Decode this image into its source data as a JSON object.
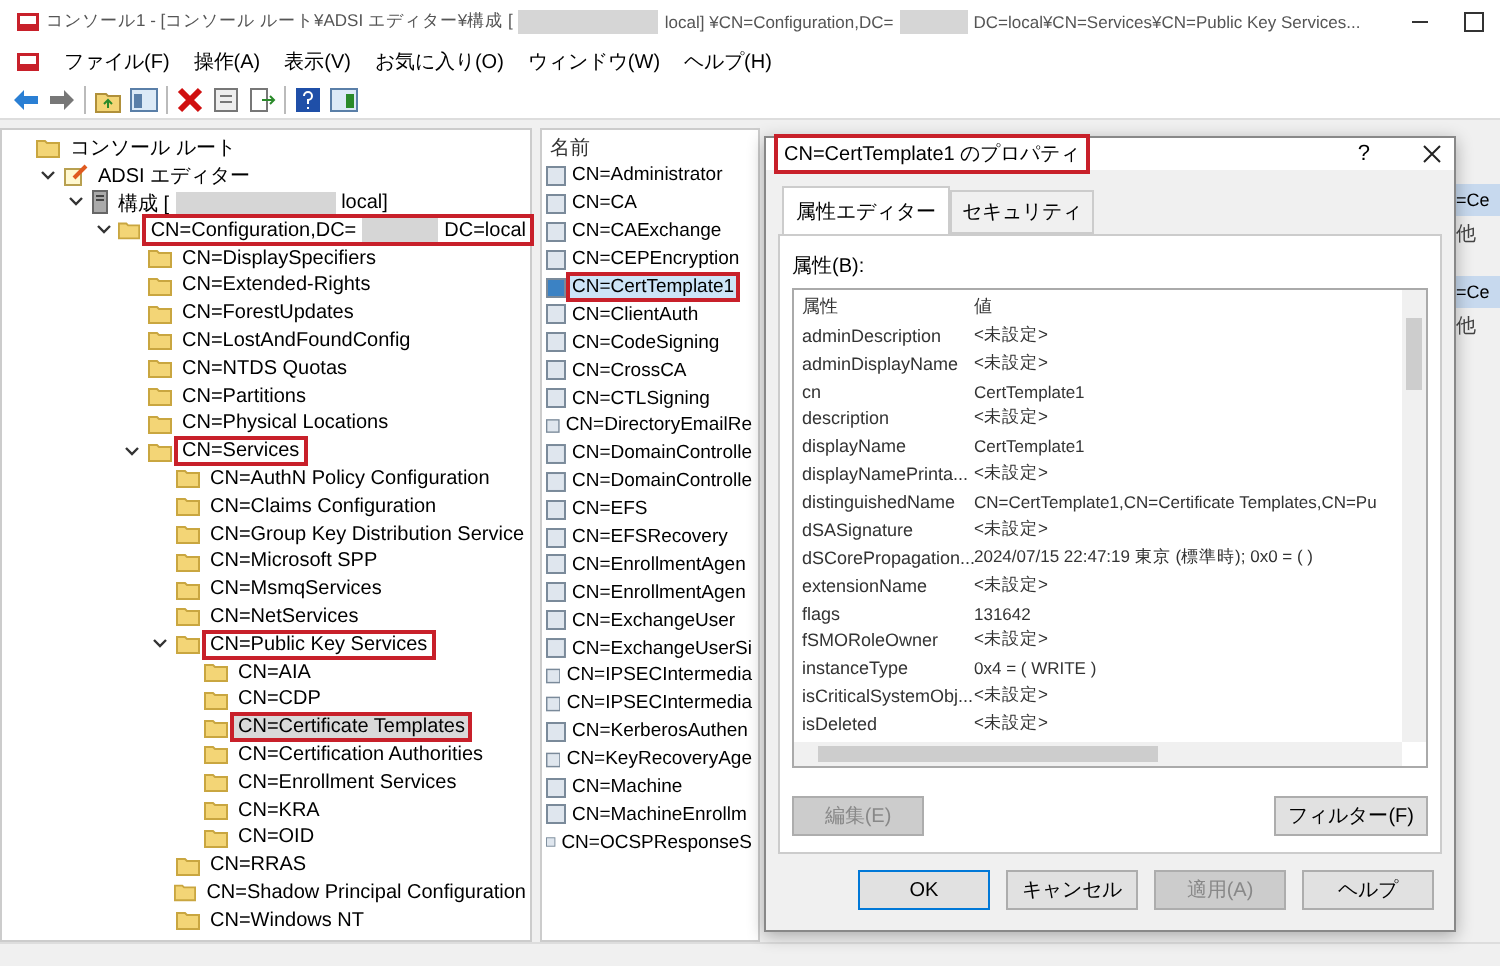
{
  "window": {
    "title_parts": [
      "コンソール1 - [コンソール ルート¥ADSI エディター¥構成 [",
      "local] ¥CN=Configuration,DC=",
      "DC=local¥CN=Services¥CN=Public Key Services..."
    ]
  },
  "menu": [
    "ファイル(F)",
    "操作(A)",
    "表示(V)",
    "お気に入り(O)",
    "ウィンドウ(W)",
    "ヘルプ(H)"
  ],
  "tree": [
    {
      "label_parts": [
        "コンソール ルート"
      ],
      "kind": "folder",
      "selected": false,
      "highlighted": false,
      "children": [
        {
          "label_parts": [
            "ADSI エディター"
          ],
          "kind": "editor",
          "expanded": true,
          "selected": false,
          "highlighted": false,
          "children": [
            {
              "label_parts": [
                "構成 [",
                "local]"
              ],
              "kind": "server",
              "expanded": true,
              "selected": false,
              "highlighted": false,
              "children": [
                {
                  "label_parts": [
                    "CN=Configuration,DC=",
                    "DC=local"
                  ],
                  "kind": "folder",
                  "expanded": true,
                  "selected": false,
                  "highlighted": true,
                  "children": [
                    {
                      "label_parts": [
                        "CN=DisplaySpecifiers"
                      ],
                      "kind": "folder",
                      "selected": false,
                      "highlighted": false
                    },
                    {
                      "label_parts": [
                        "CN=Extended-Rights"
                      ],
                      "kind": "folder",
                      "selected": false,
                      "highlighted": false
                    },
                    {
                      "label_parts": [
                        "CN=ForestUpdates"
                      ],
                      "kind": "folder",
                      "selected": false,
                      "highlighted": false
                    },
                    {
                      "label_parts": [
                        "CN=LostAndFoundConfig"
                      ],
                      "kind": "folder",
                      "selected": false,
                      "highlighted": false
                    },
                    {
                      "label_parts": [
                        "CN=NTDS Quotas"
                      ],
                      "kind": "folder",
                      "selected": false,
                      "highlighted": false
                    },
                    {
                      "label_parts": [
                        "CN=Partitions"
                      ],
                      "kind": "folder",
                      "selected": false,
                      "highlighted": false
                    },
                    {
                      "label_parts": [
                        "CN=Physical Locations"
                      ],
                      "kind": "folder",
                      "selected": false,
                      "highlighted": false
                    },
                    {
                      "label_parts": [
                        "CN=Services"
                      ],
                      "kind": "folder",
                      "expanded": true,
                      "selected": false,
                      "highlighted": true,
                      "children": [
                        {
                          "label_parts": [
                            "CN=AuthN Policy Configuration"
                          ],
                          "kind": "folder",
                          "selected": false,
                          "highlighted": false
                        },
                        {
                          "label_parts": [
                            "CN=Claims Configuration"
                          ],
                          "kind": "folder",
                          "selected": false,
                          "highlighted": false
                        },
                        {
                          "label_parts": [
                            "CN=Group Key Distribution Service"
                          ],
                          "kind": "folder",
                          "selected": false,
                          "highlighted": false
                        },
                        {
                          "label_parts": [
                            "CN=Microsoft SPP"
                          ],
                          "kind": "folder",
                          "selected": false,
                          "highlighted": false
                        },
                        {
                          "label_parts": [
                            "CN=MsmqServices"
                          ],
                          "kind": "folder",
                          "selected": false,
                          "highlighted": false
                        },
                        {
                          "label_parts": [
                            "CN=NetServices"
                          ],
                          "kind": "folder",
                          "selected": false,
                          "highlighted": false
                        },
                        {
                          "label_parts": [
                            "CN=Public Key Services"
                          ],
                          "kind": "folder",
                          "expanded": true,
                          "selected": false,
                          "highlighted": true,
                          "children": [
                            {
                              "label_parts": [
                                "CN=AIA"
                              ],
                              "kind": "folder",
                              "selected": false,
                              "highlighted": false
                            },
                            {
                              "label_parts": [
                                "CN=CDP"
                              ],
                              "kind": "folder",
                              "selected": false,
                              "highlighted": false
                            },
                            {
                              "label_parts": [
                                "CN=Certificate Templates"
                              ],
                              "kind": "folder",
                              "selected": true,
                              "highlighted": true
                            },
                            {
                              "label_parts": [
                                "CN=Certification Authorities"
                              ],
                              "kind": "folder",
                              "selected": false,
                              "highlighted": false
                            },
                            {
                              "label_parts": [
                                "CN=Enrollment Services"
                              ],
                              "kind": "folder",
                              "selected": false,
                              "highlighted": false
                            },
                            {
                              "label_parts": [
                                "CN=KRA"
                              ],
                              "kind": "folder",
                              "selected": false,
                              "highlighted": false
                            },
                            {
                              "label_parts": [
                                "CN=OID"
                              ],
                              "kind": "folder",
                              "selected": false,
                              "highlighted": false
                            }
                          ]
                        },
                        {
                          "label_parts": [
                            "CN=RRAS"
                          ],
                          "kind": "folder",
                          "selected": false,
                          "highlighted": false
                        },
                        {
                          "label_parts": [
                            "CN=Shadow Principal Configuration"
                          ],
                          "kind": "folder",
                          "selected": false,
                          "highlighted": false
                        },
                        {
                          "label_parts": [
                            "CN=Windows NT"
                          ],
                          "kind": "folder",
                          "selected": false,
                          "highlighted": false
                        }
                      ]
                    }
                  ]
                }
              ]
            }
          ]
        }
      ]
    }
  ],
  "list": {
    "column": "名前",
    "items": [
      {
        "label": "CN=Administrator",
        "selected": false,
        "highlighted": false
      },
      {
        "label": "CN=CA",
        "selected": false,
        "highlighted": false
      },
      {
        "label": "CN=CAExchange",
        "selected": false,
        "highlighted": false
      },
      {
        "label": "CN=CEPEncryption",
        "selected": false,
        "highlighted": false
      },
      {
        "label": "CN=CertTemplate1",
        "selected": true,
        "highlighted": true
      },
      {
        "label": "CN=ClientAuth",
        "selected": false,
        "highlighted": false
      },
      {
        "label": "CN=CodeSigning",
        "selected": false,
        "highlighted": false
      },
      {
        "label": "CN=CrossCA",
        "selected": false,
        "highlighted": false
      },
      {
        "label": "CN=CTLSigning",
        "selected": false,
        "highlighted": false
      },
      {
        "label": "CN=DirectoryEmailRe",
        "selected": false,
        "highlighted": false
      },
      {
        "label": "CN=DomainControlle",
        "selected": false,
        "highlighted": false
      },
      {
        "label": "CN=DomainControlle",
        "selected": false,
        "highlighted": false
      },
      {
        "label": "CN=EFS",
        "selected": false,
        "highlighted": false
      },
      {
        "label": "CN=EFSRecovery",
        "selected": false,
        "highlighted": false
      },
      {
        "label": "CN=EnrollmentAgen",
        "selected": false,
        "highlighted": false
      },
      {
        "label": "CN=EnrollmentAgen",
        "selected": false,
        "highlighted": false
      },
      {
        "label": "CN=ExchangeUser",
        "selected": false,
        "highlighted": false
      },
      {
        "label": "CN=ExchangeUserSi",
        "selected": false,
        "highlighted": false
      },
      {
        "label": "CN=IPSECIntermedia",
        "selected": false,
        "highlighted": false
      },
      {
        "label": "CN=IPSECIntermedia",
        "selected": false,
        "highlighted": false
      },
      {
        "label": "CN=KerberosAuthen",
        "selected": false,
        "highlighted": false
      },
      {
        "label": "CN=KeyRecoveryAge",
        "selected": false,
        "highlighted": false
      },
      {
        "label": "CN=Machine",
        "selected": false,
        "highlighted": false
      },
      {
        "label": "CN=MachineEnrollm",
        "selected": false,
        "highlighted": false
      },
      {
        "label": "CN=OCSPResponseS",
        "selected": false,
        "highlighted": false
      }
    ]
  },
  "actions": [
    {
      "header": "=Ce",
      "item": "他"
    },
    {
      "header": "=Ce",
      "item": "他"
    }
  ],
  "dialog": {
    "title": "CN=CertTemplate1 のプロパティ",
    "title_highlighted": true,
    "help": "?",
    "tabs": [
      {
        "label": "属性エディター",
        "selected": true
      },
      {
        "label": "セキュリティ",
        "selected": false
      }
    ],
    "attributes_label": "属性(B):",
    "columns": [
      "属性",
      "値"
    ],
    "rows": [
      [
        "adminDescription",
        "<未設定>"
      ],
      [
        "adminDisplayName",
        "<未設定>"
      ],
      [
        "cn",
        "CertTemplate1"
      ],
      [
        "description",
        "<未設定>"
      ],
      [
        "displayName",
        "CertTemplate1"
      ],
      [
        "displayNamePrinta...",
        "<未設定>"
      ],
      [
        "distinguishedName",
        "CN=CertTemplate1,CN=Certificate Templates,CN=Pu"
      ],
      [
        "dSASignature",
        "<未設定>"
      ],
      [
        "dSCorePropagation...",
        "2024/07/15 22:47:19 東京 (標準時); 0x0 = ( )"
      ],
      [
        "extensionName",
        "<未設定>"
      ],
      [
        "flags",
        "131642"
      ],
      [
        "fSMORoleOwner",
        "<未設定>"
      ],
      [
        "instanceType",
        "0x4 = ( WRITE )"
      ],
      [
        "isCriticalSystemObj...",
        "<未設定>"
      ],
      [
        "isDeleted",
        "<未設定>"
      ]
    ],
    "edit_button": {
      "label": "編集(E)",
      "disabled": true
    },
    "filter_button": {
      "label": "フィルター(F)",
      "disabled": false
    },
    "buttons": [
      {
        "label": "OK",
        "disabled": false,
        "default": true
      },
      {
        "label": "キャンセル",
        "disabled": false,
        "default": false
      },
      {
        "label": "適用(A)",
        "disabled": true,
        "default": false
      },
      {
        "label": "ヘルプ",
        "disabled": false,
        "default": false
      }
    ]
  }
}
